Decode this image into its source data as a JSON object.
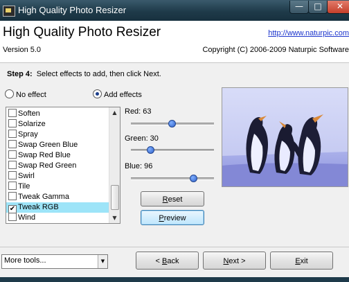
{
  "window": {
    "title": "High Quality Photo Resizer"
  },
  "titlebar_buttons": {
    "minimize": "—",
    "maximize": "□",
    "close": "✕"
  },
  "header": {
    "app_name": "High Quality Photo Resizer",
    "link": "http://www.naturpic.com",
    "version": "Version 5.0",
    "copyright": "Copyright (C) 2006-2009 Naturpic Software"
  },
  "step": {
    "label": "Step 4:",
    "text": "Select effects to add, then click Next."
  },
  "mode": {
    "no_effect": "No effect",
    "add_effects": "Add effects",
    "selected": "add_effects"
  },
  "effects": [
    {
      "label": "Soften",
      "checked": false
    },
    {
      "label": "Solarize",
      "checked": false
    },
    {
      "label": "Spray",
      "checked": false
    },
    {
      "label": "Swap Green Blue",
      "checked": false
    },
    {
      "label": "Swap Red Blue",
      "checked": false
    },
    {
      "label": "Swap Red Green",
      "checked": false
    },
    {
      "label": "Swirl",
      "checked": false
    },
    {
      "label": "Tile",
      "checked": false
    },
    {
      "label": "Tweak Gamma",
      "checked": false
    },
    {
      "label": "Tweak RGB",
      "checked": true,
      "selected": true
    },
    {
      "label": "Wind",
      "checked": false
    }
  ],
  "sliders": {
    "red": {
      "label": "Red: 63",
      "value": 63
    },
    "green": {
      "label": "Green: 30",
      "value": 30
    },
    "blue": {
      "label": "Blue: 96",
      "value": 96
    }
  },
  "buttons": {
    "reset": {
      "accel": "R",
      "rest": "eset"
    },
    "preview": {
      "accel": "P",
      "rest": "review"
    },
    "back": {
      "pre": "< ",
      "accel": "B",
      "rest": "ack"
    },
    "next": {
      "accel": "N",
      "rest": "ext >"
    },
    "exit": {
      "accel": "E",
      "rest": "xit"
    }
  },
  "more_tools": "More tools...",
  "colors": {
    "titlebar": "#1f3b4a",
    "selection": "#9de4f8",
    "link": "#1a33cc"
  }
}
